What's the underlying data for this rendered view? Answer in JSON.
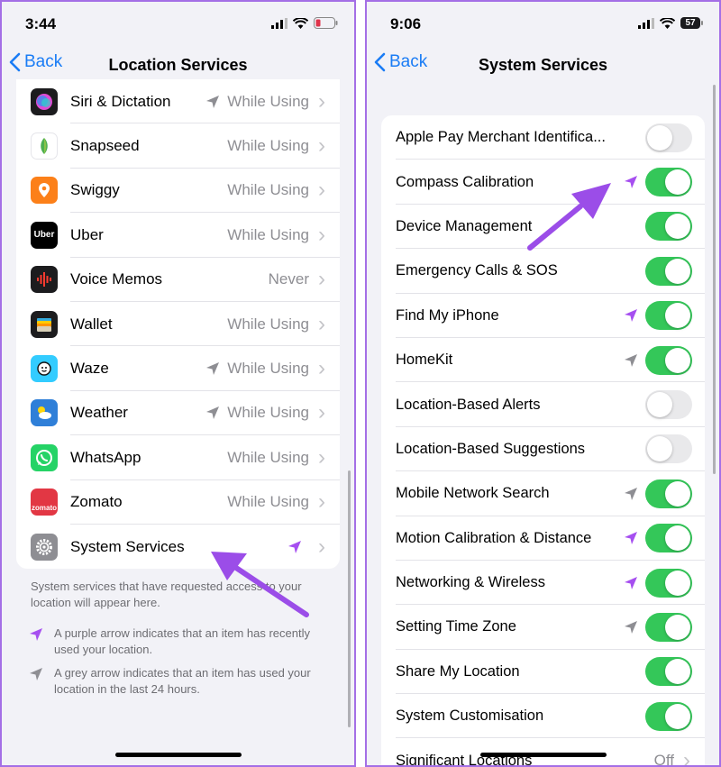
{
  "left": {
    "status": {
      "time": "3:44"
    },
    "nav": {
      "back": "Back",
      "title": "Location Services"
    },
    "apps": [
      {
        "name": "Siri & Dictation",
        "value": "While Using",
        "arrow": "grey",
        "icon": "siri-icon",
        "color": "#1c1c1e"
      },
      {
        "name": "Snapseed",
        "value": "While Using",
        "arrow": null,
        "icon": "snapseed-icon",
        "color": "#ffffff"
      },
      {
        "name": "Swiggy",
        "value": "While Using",
        "arrow": null,
        "icon": "swiggy-icon",
        "color": "#fc8019"
      },
      {
        "name": "Uber",
        "value": "While Using",
        "arrow": null,
        "icon": "uber-icon",
        "color": "#000000",
        "text": "Uber"
      },
      {
        "name": "Voice Memos",
        "value": "Never",
        "arrow": null,
        "icon": "voice-memos-icon",
        "color": "#1c1c1e"
      },
      {
        "name": "Wallet",
        "value": "While Using",
        "arrow": null,
        "icon": "wallet-icon",
        "color": "#1c1c1e"
      },
      {
        "name": "Waze",
        "value": "While Using",
        "arrow": "grey",
        "icon": "waze-icon",
        "color": "#33ccff"
      },
      {
        "name": "Weather",
        "value": "While Using",
        "arrow": "grey",
        "icon": "weather-icon",
        "color": "#2f7fd8"
      },
      {
        "name": "WhatsApp",
        "value": "While Using",
        "arrow": null,
        "icon": "whatsapp-icon",
        "color": "#25d366"
      },
      {
        "name": "Zomato",
        "value": "While Using",
        "arrow": null,
        "icon": "zomato-icon",
        "color": "#e23744",
        "text": "zomato"
      },
      {
        "name": "System Services",
        "value": "",
        "arrow": "purple",
        "icon": "gear-icon",
        "color": "#8e8e93"
      }
    ],
    "footer": "System services that have requested access to your location will appear here.",
    "legend_purple": "A purple arrow indicates that an item has recently used your location.",
    "legend_grey": "A grey arrow indicates that an item has used your location in the last 24 hours."
  },
  "right": {
    "status": {
      "time": "9:06",
      "battery": "57"
    },
    "nav": {
      "back": "Back",
      "title": "System Services"
    },
    "services": [
      {
        "name": "Apple Pay Merchant Identifica...",
        "on": false,
        "arrow": null
      },
      {
        "name": "Compass Calibration",
        "on": true,
        "arrow": "purple"
      },
      {
        "name": "Device Management",
        "on": true,
        "arrow": null
      },
      {
        "name": "Emergency Calls & SOS",
        "on": true,
        "arrow": null
      },
      {
        "name": "Find My iPhone",
        "on": true,
        "arrow": "purple"
      },
      {
        "name": "HomeKit",
        "on": true,
        "arrow": "grey"
      },
      {
        "name": "Location-Based Alerts",
        "on": false,
        "arrow": null
      },
      {
        "name": "Location-Based Suggestions",
        "on": false,
        "arrow": null
      },
      {
        "name": "Mobile Network Search",
        "on": true,
        "arrow": "grey"
      },
      {
        "name": "Motion Calibration & Distance",
        "on": true,
        "arrow": "purple"
      },
      {
        "name": "Networking & Wireless",
        "on": true,
        "arrow": "purple"
      },
      {
        "name": "Setting Time Zone",
        "on": true,
        "arrow": "grey"
      },
      {
        "name": "Share My Location",
        "on": true,
        "arrow": null
      },
      {
        "name": "System Customisation",
        "on": true,
        "arrow": null
      }
    ],
    "last_row": {
      "name": "Significant Locations",
      "value": "Off"
    }
  },
  "colors": {
    "accent": "#1a7cf5",
    "toggle_on": "#34c759",
    "purple_arrow": "#a64ff0",
    "grey_arrow": "#8e8e93",
    "annotation": "#9b4de8",
    "frame": "#a46fe6"
  }
}
